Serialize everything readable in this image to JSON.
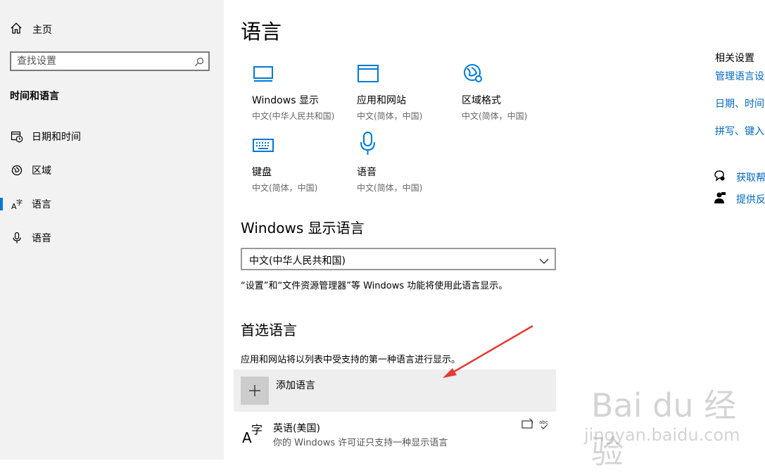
{
  "sidebar": {
    "home_label": "主页",
    "search_placeholder": "查找设置",
    "section_title": "时间和语言",
    "items": [
      {
        "label": "日期和时间"
      },
      {
        "label": "区域"
      },
      {
        "label": "语言"
      },
      {
        "label": "语音"
      }
    ]
  },
  "main": {
    "title": "语言",
    "tiles": [
      {
        "name": "Windows 显示",
        "sub": "中文(中华人民共和国)"
      },
      {
        "name": "应用和网站",
        "sub": "中文(简体，中国)"
      },
      {
        "name": "区域格式",
        "sub": "中文(简体，中国)"
      },
      {
        "name": "键盘",
        "sub": "中文(简体，中国)"
      },
      {
        "name": "语音",
        "sub": "中文(简体，中国)"
      }
    ],
    "display_language": {
      "heading": "Windows 显示语言",
      "selected": "中文(中华人民共和国)",
      "description": "“设置”和“文件资源管理器”等 Windows 功能将使用此语言显示。"
    },
    "preferred": {
      "heading": "首选语言",
      "description": "应用和网站将以列表中受支持的第一种语言进行显示。",
      "add_label": "添加语言",
      "languages": [
        {
          "name": "英语(美国)",
          "note": "你的 Windows 许可证只支持一种显示语言"
        }
      ]
    }
  },
  "related": {
    "title": "相关设置",
    "links": [
      "管理语言设",
      "日期、时间",
      "拼写、键入"
    ]
  },
  "help": {
    "get_help": "获取帮",
    "feedback": "提供反"
  },
  "watermark": {
    "brand": "Bai du 经验",
    "site": "jingyan.baidu.com"
  },
  "colors": {
    "accent": "#0078d7",
    "link": "#0067c0",
    "arrow": "#e53935"
  }
}
